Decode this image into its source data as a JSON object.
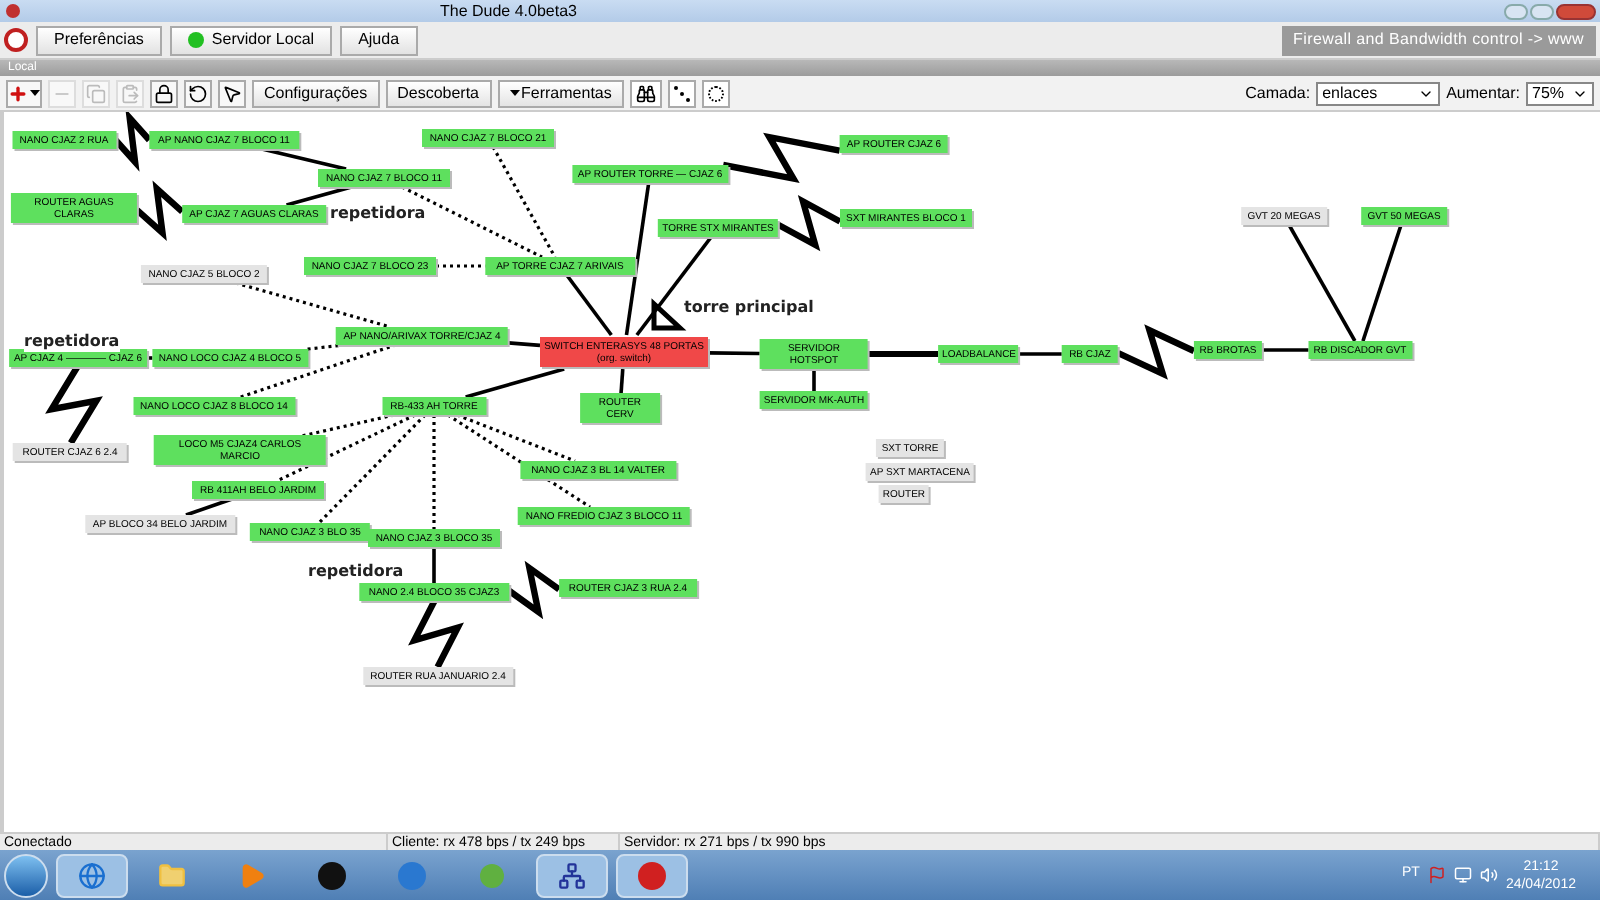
{
  "window": {
    "title": "The Dude 4.0beta3"
  },
  "menu": {
    "items": [
      {
        "label": "Preferências",
        "kind": "plain"
      },
      {
        "label": "Servidor Local",
        "kind": "server",
        "connected": true
      },
      {
        "label": "Ajuda",
        "kind": "plain"
      }
    ],
    "banner": "Firewall and Bandwidth control -> www"
  },
  "panel": {
    "title": "Local"
  },
  "toolbar": {
    "tools": [
      {
        "kind": "add",
        "disabled": false
      },
      {
        "kind": "remove",
        "disabled": true
      },
      {
        "kind": "copy",
        "disabled": true
      },
      {
        "kind": "paste",
        "disabled": true
      },
      {
        "kind": "lock",
        "disabled": false
      },
      {
        "kind": "undo",
        "disabled": false
      },
      {
        "kind": "pointer",
        "disabled": false
      }
    ],
    "buttons": [
      {
        "label": "Configurações",
        "kind": "plain"
      },
      {
        "label": "Descoberta",
        "kind": "plain"
      },
      {
        "label": "Ferramentas",
        "kind": "menu"
      }
    ],
    "layer_label": "Camada:",
    "layer_value": "enlaces",
    "zoom_label": "Aumentar:",
    "zoom_value": "75%"
  },
  "nodes": [
    {
      "label": "NANO CJAZ 2 RUA",
      "color": "#5ee05e"
    },
    {
      "label": "AP NANO CJAZ 7 BLOCO 11",
      "color": "#5ee05e"
    },
    {
      "label": "NANO CJAZ 7 BLOCO 21",
      "color": "#5ee05e"
    },
    {
      "label": "AP ROUTER CJAZ 6",
      "color": "#5ee05e"
    },
    {
      "label": "NANO CJAZ 7 BLOCO 11",
      "color": "#5ee05e"
    },
    {
      "label": "AP ROUTER TORRE — CJAZ 6",
      "color": "#5ee05e"
    },
    {
      "label": "ROUTER AGUAS CLARAS",
      "color": "#5ee05e"
    },
    {
      "label": "AP CJAZ 7 AGUAS CLARAS",
      "color": "#5ee05e"
    },
    {
      "label": "TORRE STX MIRANTES",
      "color": "#5ee05e"
    },
    {
      "label": "SXT MIRANTES BLOCO 1",
      "color": "#5ee05e"
    },
    {
      "label": "GVT 20 MEGAS",
      "color": "#e4e4e4"
    },
    {
      "label": "GVT 50 MEGAS",
      "color": "#5ee05e"
    },
    {
      "label": "NANO CJAZ 5 BLOCO 2",
      "color": "#e4e4e4"
    },
    {
      "label": "NANO CJAZ 7 BLOCO 23",
      "color": "#5ee05e"
    },
    {
      "label": "AP TORRE CJAZ 7 ARIVAIS",
      "color": "#5ee05e"
    },
    {
      "label": "AP CJAZ 4 ———— CJAZ 6",
      "color": "#5ee05e"
    },
    {
      "label": "NANO LOCO CJAZ 4 BLOCO 5",
      "color": "#5ee05e"
    },
    {
      "label": "AP NANO/ARIVAX TORRE/CJAZ 4",
      "color": "#5ee05e"
    },
    {
      "label": "SWITCH ENTERASYS 48 PORTAS (org. switch)",
      "color": "#f04848"
    },
    {
      "label": "SERVIDOR HOTSPOT",
      "color": "#5ee05e"
    },
    {
      "label": "LOADBALANCE",
      "color": "#5ee05e"
    },
    {
      "label": "RB CJAZ",
      "color": "#5ee05e"
    },
    {
      "label": "RB BROTAS",
      "color": "#5ee05e"
    },
    {
      "label": "RB DISCADOR GVT",
      "color": "#5ee05e"
    },
    {
      "label": "NANO LOCO CJAZ 8 BLOCO 14",
      "color": "#5ee05e"
    },
    {
      "label": "RB-433 AH TORRE",
      "color": "#5ee05e"
    },
    {
      "label": "ROUTER CERV",
      "color": "#5ee05e"
    },
    {
      "label": "SERVIDOR MK-AUTH",
      "color": "#5ee05e"
    },
    {
      "label": "ROUTER CJAZ 6 2.4",
      "color": "#e4e4e4"
    },
    {
      "label": "LOCO M5 CJAZ4 CARLOS MARCIO",
      "color": "#5ee05e"
    },
    {
      "label": "NANO CJAZ 3 BL 14 VALTER",
      "color": "#5ee05e"
    },
    {
      "label": "SXT TORRE",
      "color": "#e4e4e4"
    },
    {
      "label": "AP SXT MARTACENA",
      "color": "#e4e4e4"
    },
    {
      "label": "RB 411AH BELO JARDIM",
      "color": "#5ee05e"
    },
    {
      "label": "ROUTER",
      "color": "#e4e4e4"
    },
    {
      "label": "AP BLOCO 34 BELO JARDIM",
      "color": "#e4e4e4"
    },
    {
      "label": "NANO CJAZ 3 BLO 35",
      "color": "#5ee05e"
    },
    {
      "label": "NANO CJAZ 3 BLOCO 35",
      "color": "#5ee05e"
    },
    {
      "label": "NANO FREDIO CJAZ 3 BLOCO 11",
      "color": "#5ee05e"
    },
    {
      "label": "NANO 2.4 BLOCO 35 CJAZ3",
      "color": "#5ee05e"
    },
    {
      "label": "ROUTER CJAZ 3 RUA 2.4",
      "color": "#5ee05e"
    },
    {
      "label": "ROUTER RUA JANUARIO 2.4",
      "color": "#e4e4e4"
    }
  ],
  "annotations": [
    "repetidora",
    "repetidora",
    "repetidora",
    "torre principal"
  ],
  "status_bar": [
    "Conectado",
    "Cliente: rx 478 bps / tx 249 bps",
    "Servidor: rx 271 bps / tx 990 bps"
  ],
  "taskbar": {
    "language": "PT",
    "time": "21:12",
    "date": "24/04/2012"
  }
}
